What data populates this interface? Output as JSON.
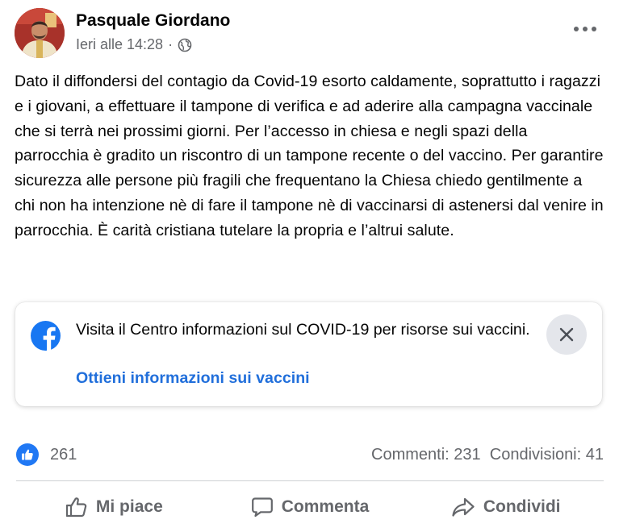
{
  "post": {
    "author": "Pasquale Giordano",
    "timestamp": "Ieri alle 14:28",
    "separator": "·",
    "audience_icon": "globe-icon",
    "more_icon": "more-options-icon",
    "text": "Dato il diffondersi del contagio da Covid-19 esorto caldamente, soprattutto i ragazzi e i giovani, a effettuare il tampone di verifica e ad aderire alla campagna vaccinale che si terrà nei prossimi giorni. Per l’accesso in chiesa e negli spazi della parrocchia è gradito un riscontro di un tampone recente o del vaccino. Per garantire sicurezza alle persone più fragili che frequentano la Chiesa chiedo gentilmente a chi non ha intenzione nè di fare il tampone nè di vaccinarsi di astenersi dal venire in parrocchia. È carità cristiana tutelare la propria e l’altrui salute."
  },
  "info_card": {
    "text": "Visita il Centro informazioni sul COVID-19 per risorse sui vaccini.",
    "link": "Ottieni informazioni sui vaccini",
    "logo_icon": "facebook-logo-icon",
    "close_icon": "close-icon"
  },
  "stats": {
    "likes": "261",
    "comments": "Commenti: 231",
    "shares": "Condivisioni: 41"
  },
  "actions": {
    "like": "Mi piace",
    "comment": "Commenta",
    "share": "Condividi"
  },
  "colors": {
    "facebook_blue": "#1877f2",
    "link_blue": "#216fdb",
    "secondary_text": "#65676b",
    "like_badge": "#2078f4"
  }
}
